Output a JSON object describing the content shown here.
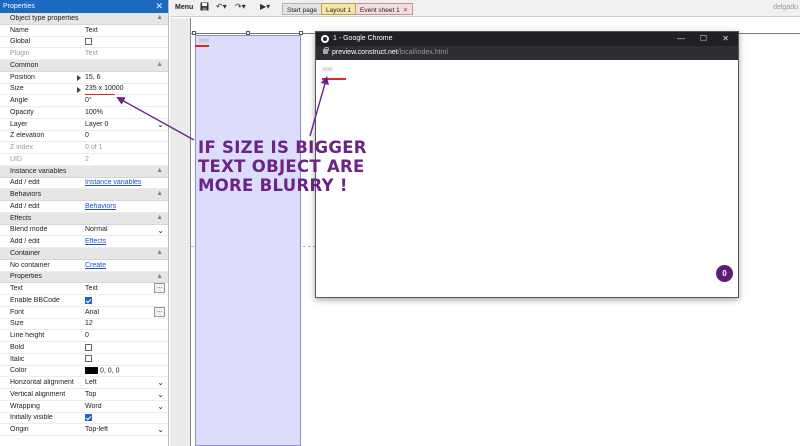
{
  "properties_panel": {
    "title": "Properties",
    "close_glyph": "✕",
    "rows": [
      {
        "kind": "section",
        "label": "Object type properties"
      },
      {
        "kind": "text",
        "label": "Name",
        "value": "Text"
      },
      {
        "kind": "check",
        "label": "Global",
        "checked": false
      },
      {
        "kind": "text",
        "label": "Plugin",
        "value": "Text",
        "disabled": true
      },
      {
        "kind": "section",
        "label": "Common"
      },
      {
        "kind": "expand",
        "label": "Position",
        "value": "15, 6"
      },
      {
        "kind": "expand",
        "label": "Size",
        "value": "235 x 10000",
        "highlight": true
      },
      {
        "kind": "text",
        "label": "Angle",
        "value": "0°"
      },
      {
        "kind": "text",
        "label": "Opacity",
        "value": "100%"
      },
      {
        "kind": "select",
        "label": "Layer",
        "value": "Layer 0"
      },
      {
        "kind": "text",
        "label": "Z elevation",
        "value": "0"
      },
      {
        "kind": "text",
        "label": "Z index",
        "value": "0 of 1",
        "disabled": true
      },
      {
        "kind": "text",
        "label": "UID",
        "value": "2",
        "disabled": true
      },
      {
        "kind": "section",
        "label": "Instance variables"
      },
      {
        "kind": "link",
        "label": "Add / edit",
        "value": "Instance variables"
      },
      {
        "kind": "section",
        "label": "Behaviors"
      },
      {
        "kind": "link",
        "label": "Add / edit",
        "value": "Behaviors"
      },
      {
        "kind": "section",
        "label": "Effects"
      },
      {
        "kind": "select",
        "label": "Blend mode",
        "value": "Normal"
      },
      {
        "kind": "link",
        "label": "Add / edit",
        "value": "Effects"
      },
      {
        "kind": "section",
        "label": "Container"
      },
      {
        "kind": "link",
        "label": "No container",
        "value": "Create"
      },
      {
        "kind": "section",
        "label": "Properties"
      },
      {
        "kind": "button",
        "label": "Text",
        "value": "Text"
      },
      {
        "kind": "check",
        "label": "Enable BBCode",
        "checked": true
      },
      {
        "kind": "button",
        "label": "Font",
        "value": "Arial"
      },
      {
        "kind": "text",
        "label": "Size",
        "value": "12"
      },
      {
        "kind": "text",
        "label": "Line height",
        "value": "0"
      },
      {
        "kind": "check",
        "label": "Bold",
        "checked": false
      },
      {
        "kind": "check",
        "label": "Italic",
        "checked": false
      },
      {
        "kind": "color",
        "label": "Color",
        "value": "0, 0, 0",
        "swatch": "#000000"
      },
      {
        "kind": "select",
        "label": "Horizontal alignment",
        "value": "Left"
      },
      {
        "kind": "select",
        "label": "Vertical alignment",
        "value": "Top"
      },
      {
        "kind": "select",
        "label": "Wrapping",
        "value": "Word"
      },
      {
        "kind": "check",
        "label": "Initially visible",
        "checked": true
      },
      {
        "kind": "select",
        "label": "Origin",
        "value": "Top-left"
      }
    ]
  },
  "toolbar": {
    "menu_label": "Menu",
    "save_icon": "save-icon",
    "undo_icon": "undo-icon",
    "redo_icon": "redo-icon",
    "run_icon": "play-icon",
    "tabs": [
      {
        "label": "Start page",
        "closable": true,
        "state": "normal"
      },
      {
        "label": "Layout 1",
        "closable": true,
        "state": "active"
      },
      {
        "label": "Event sheet 1",
        "closable": true,
        "state": "event"
      }
    ],
    "user_label": "delgado"
  },
  "layout_view": {
    "text_object_content": "Text"
  },
  "chrome_window": {
    "title": "1 - Google Chrome",
    "url_host": "preview.construct.net",
    "url_path": "/local/index.html",
    "body_text": "Text",
    "badge": "0"
  },
  "annotation": {
    "lines": [
      "If size is bigger",
      "text object are",
      "more blurry !"
    ],
    "color": "#6b2386"
  },
  "colors": {
    "panel_header": "#1c69c0",
    "accent_red": "#d72b2b",
    "object_fill": "#dcdcfb",
    "chrome_dark": "#202124"
  }
}
